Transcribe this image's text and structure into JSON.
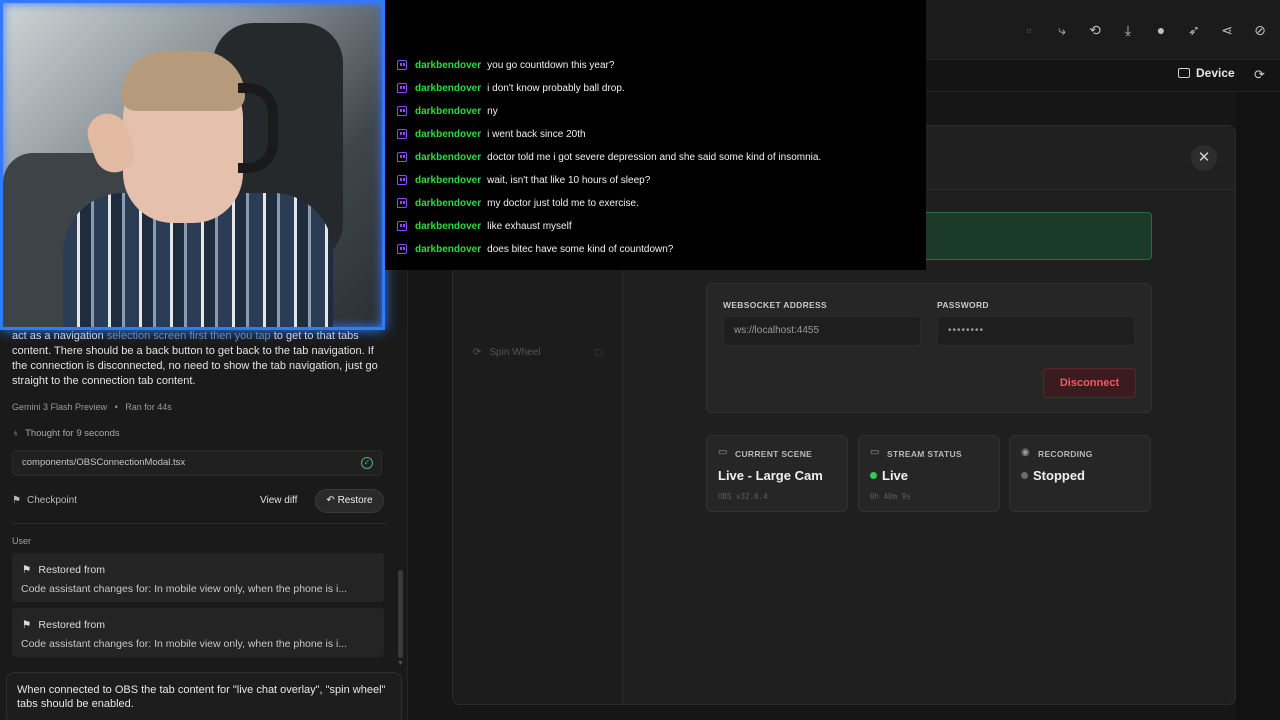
{
  "chat_overlay": {
    "messages": [
      {
        "user": "darkbendover",
        "text": "you go countdown this year?"
      },
      {
        "user": "darkbendover",
        "text": "i don't know probably ball drop."
      },
      {
        "user": "darkbendover",
        "text": "ny"
      },
      {
        "user": "darkbendover",
        "text": "i went back since 20th"
      },
      {
        "user": "darkbendover",
        "text": "doctor told me i got severe depression and she said some kind of insomnia."
      },
      {
        "user": "darkbendover",
        "text": "wait, isn't that like 10 hours of sleep?"
      },
      {
        "user": "darkbendover",
        "text": "my doctor just told me to exercise."
      },
      {
        "user": "darkbendover",
        "text": "like exhaust myself"
      },
      {
        "user": "darkbendover",
        "text": "does bitec have some kind of countdown?"
      }
    ]
  },
  "toolbar": {
    "device_label": "Device"
  },
  "assistant": {
    "message_plain_1": "act as a navigation ",
    "message_highlight": "selection screen first then you tap",
    "message_plain_2": " to get to that tabs content. There should be a back button to get back to the tab navigation. If the connection is disconnected, no need to show the tab navigation, just go straight to the connection tab content.",
    "model": "Gemini 3 Flash Preview",
    "run_time": "Ran for 44s",
    "thought": "Thought for 9 seconds",
    "file": "components/OBSConnectionModal.tsx",
    "checkpoint_label": "Checkpoint",
    "view_diff_label": "View diff",
    "restore_label": "Restore"
  },
  "history": {
    "user_label": "User",
    "items": [
      {
        "title": "Restored from",
        "desc": "Code assistant changes for: In mobile view only, when the phone is i..."
      },
      {
        "title": "Restored from",
        "desc": "Code assistant changes for: In mobile view only, when the phone is i..."
      }
    ]
  },
  "prompt_input": {
    "value": "When connected to OBS the tab content for \"live chat overlay\", \"spin wheel\" tabs should be enabled."
  },
  "modal": {
    "sidebar_item": "Spin Wheel",
    "websocket_label": "WEBSOCKET ADDRESS",
    "websocket_value": "ws://localhost:4455",
    "password_label": "PASSWORD",
    "password_value": "••••••••",
    "disconnect_label": "Disconnect",
    "stats": {
      "scene_label": "CURRENT SCENE",
      "scene_value": "Live - Large Cam",
      "scene_sub": "OBS v32.0.4",
      "stream_label": "STREAM STATUS",
      "stream_value": "Live",
      "stream_sub": "0h 40m 9s",
      "recording_label": "RECORDING",
      "recording_value": "Stopped"
    }
  },
  "colors": {
    "username": "#2bdc42",
    "twitch": "#9146ff",
    "live_dot": "#2ecc55",
    "stopped_dot": "#6b6b6b",
    "disconnect": "#ef5a65",
    "webcam_border": "#2f7bff"
  }
}
